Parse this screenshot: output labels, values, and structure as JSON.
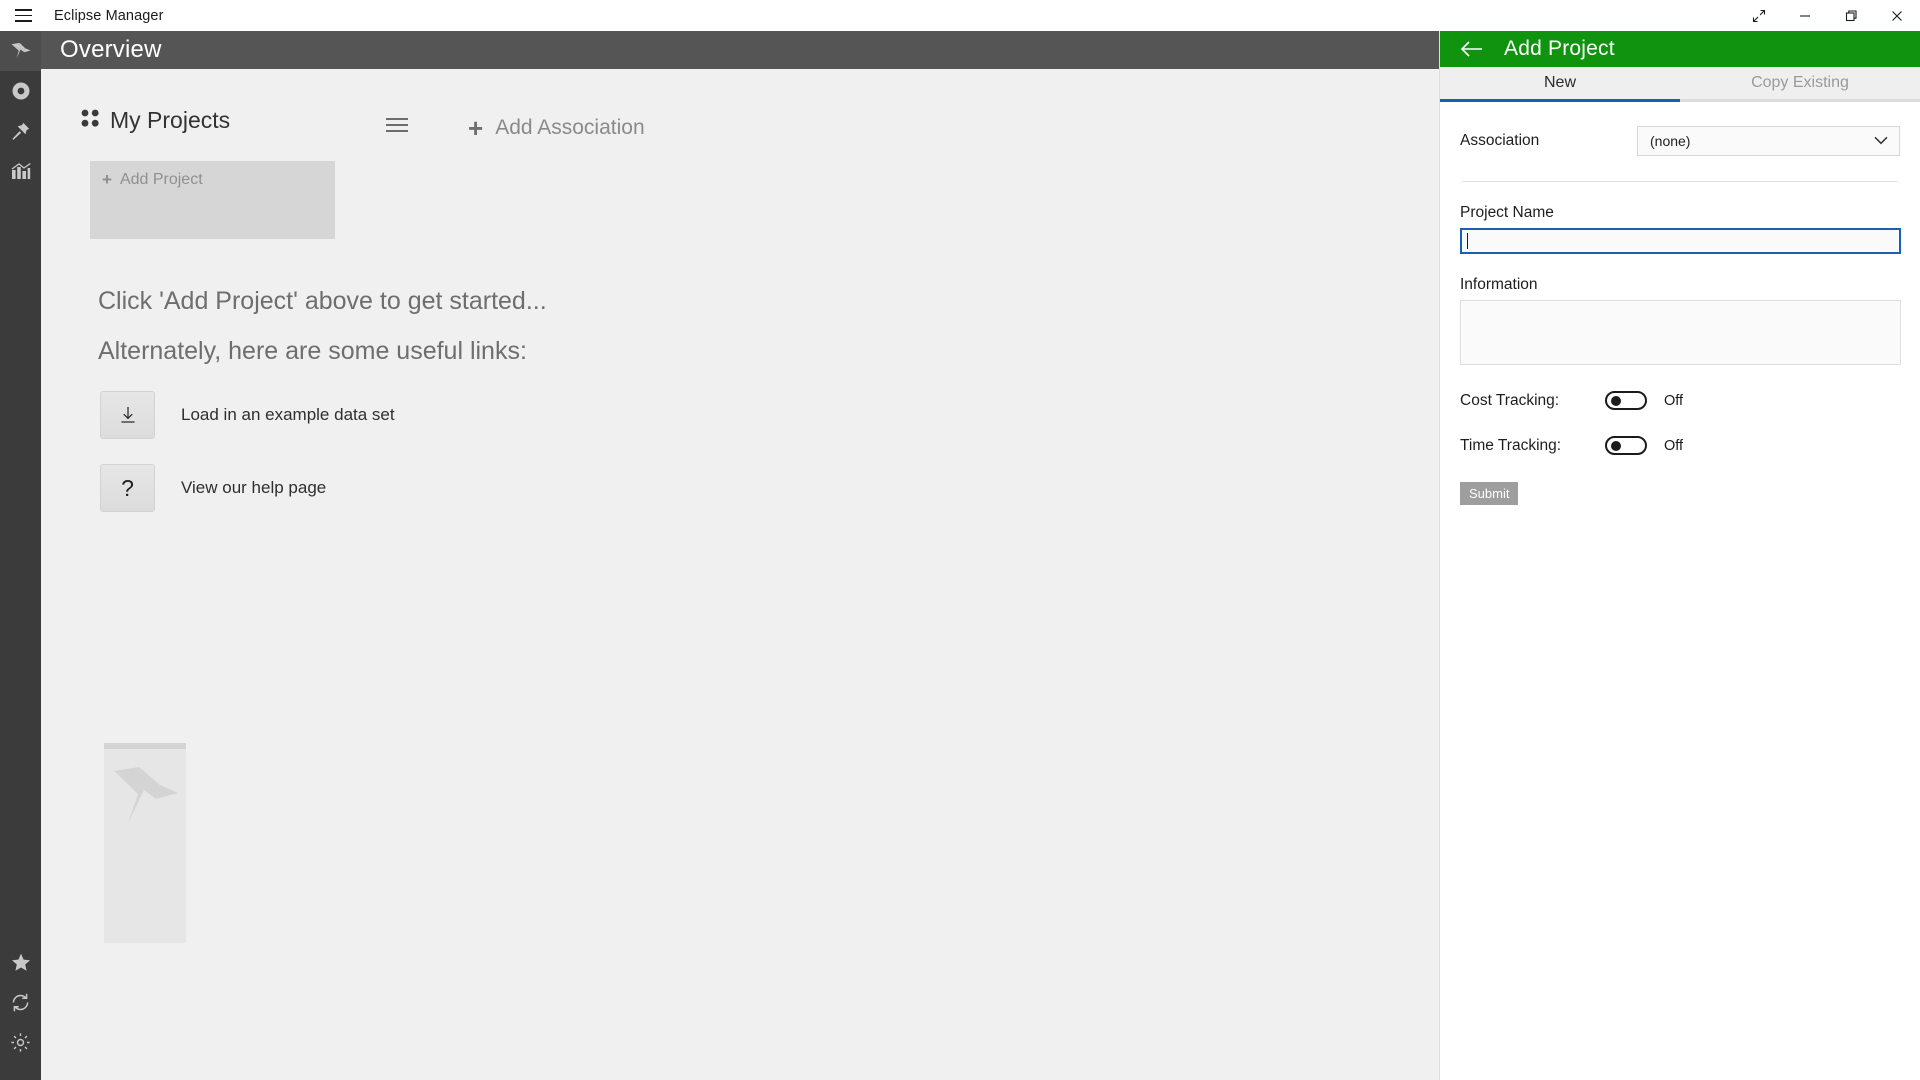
{
  "window": {
    "title": "Eclipse Manager",
    "menu_icon": "hamburger-icon",
    "controls": {
      "fullscreen": "expand-arrows-icon",
      "minimize": "minimize-icon",
      "maximize": "restore-icon",
      "close": "close-icon"
    }
  },
  "rail": {
    "top_items": [
      {
        "name": "origami-bird-icon",
        "active": true
      },
      {
        "name": "circle-record-icon",
        "active": false
      },
      {
        "name": "pin-icon",
        "active": false
      },
      {
        "name": "bar-chart-icon",
        "active": false
      }
    ],
    "bottom_items": [
      {
        "name": "star-icon"
      },
      {
        "name": "sync-refresh-icon"
      },
      {
        "name": "gear-icon"
      }
    ]
  },
  "page": {
    "title": "Overview",
    "header_bg": "#555555"
  },
  "projects": {
    "section_icon": "grid-dots-icon",
    "section_title": "My Projects",
    "menu_icon": "hamburger-icon",
    "add_project_label": "Add Project",
    "add_project_plus": "+",
    "add_association_label": "Add Association",
    "add_association_plus": "+"
  },
  "hints": {
    "line1": "Click 'Add Project' above to get started...",
    "line2": "Alternately, here are some useful links:"
  },
  "links": [
    {
      "icon": "download-icon",
      "label": "Load in an example data set"
    },
    {
      "icon": "question-mark-icon",
      "label": "View our help page"
    }
  ],
  "watermark": {
    "icon": "origami-bird-icon"
  },
  "panel": {
    "back_icon": "arrow-left-icon",
    "title": "Add Project",
    "header_color": "#109410",
    "accent_color": "#1a5fb4",
    "tabs": [
      {
        "label": "New",
        "active": true
      },
      {
        "label": "Copy Existing",
        "active": false
      }
    ],
    "association": {
      "label": "Association",
      "value": "(none)",
      "chevron_icon": "chevron-down-icon"
    },
    "project_name": {
      "label": "Project Name",
      "value": "",
      "focused": true
    },
    "information": {
      "label": "Information",
      "value": ""
    },
    "cost_tracking": {
      "label": "Cost Tracking:",
      "state": "Off",
      "on": false
    },
    "time_tracking": {
      "label": "Time Tracking:",
      "state": "Off",
      "on": false
    },
    "submit_label": "Submit"
  }
}
